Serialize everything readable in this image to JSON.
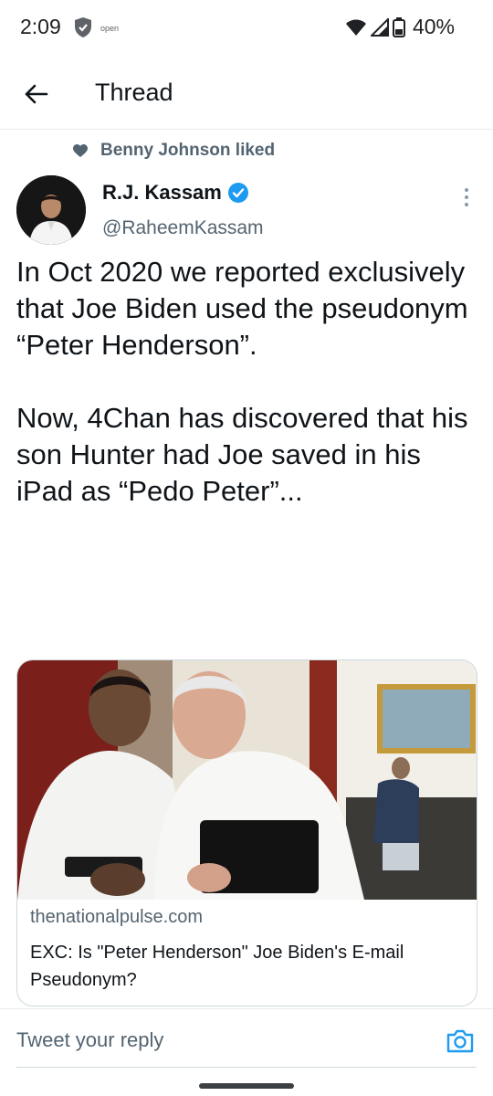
{
  "status_bar": {
    "time": "2:09",
    "open_label": "open",
    "battery": "40%"
  },
  "header": {
    "title": "Thread"
  },
  "social_context": {
    "text": "Benny Johnson liked"
  },
  "tweet": {
    "author_name": "R.J. Kassam",
    "author_handle": "@RaheemKassam",
    "verified": true,
    "text": "In Oct 2020 we reported exclusively that Joe Biden used the pseudonym “Peter Henderson”.\n\nNow, 4Chan has discovered that his son Hunter had Joe saved in his iPad as “Pedo Peter”..."
  },
  "link_card": {
    "domain": "thenationalpulse.com",
    "title": "EXC: Is \"Peter Henderson\" Joe Biden's E-mail Pseudonym?"
  },
  "reply": {
    "placeholder": "Tweet your reply"
  },
  "colors": {
    "accent": "#1d9bf0",
    "text_primary": "#0f1419",
    "text_secondary": "#536471",
    "border": "#cfd9de"
  }
}
